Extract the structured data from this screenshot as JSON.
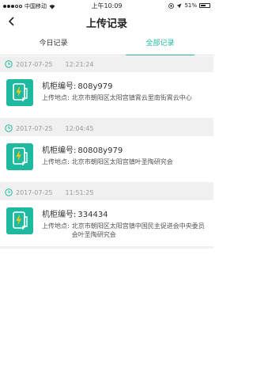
{
  "status_bar": {
    "carrier": "中国移动",
    "time": "上午10:09",
    "battery": "51%",
    "battery_level": 0.51
  },
  "nav": {
    "title": "上传记录"
  },
  "tabs": [
    {
      "label": "今日记录",
      "active": false
    },
    {
      "label": "全部记录",
      "active": true
    }
  ],
  "records": [
    {
      "date": "2017-07-25",
      "time": "12:21:24",
      "cabinet_label": "机柜编号:",
      "cabinet_no": "808y979",
      "location_label": "上传地点:",
      "location": "北京市朝阳区太阳宫镇霄云里南街霄云中心"
    },
    {
      "date": "2017-07-25",
      "time": "12:04:45",
      "cabinet_label": "机柜编号:",
      "cabinet_no": "80808y979",
      "location_label": "上传地点:",
      "location": "北京市朝阳区太阳宫镇叶圣陶研究会"
    },
    {
      "date": "2017-07-25",
      "time": "11:51:25",
      "cabinet_label": "机柜编号:",
      "cabinet_no": "334434",
      "location_label": "上传地点:",
      "location": "北京市朝阳区太阳宫镇中国民主促进会中央委员会叶圣陶研究会"
    }
  ],
  "colors": {
    "accent": "#1fb9a0",
    "background": "#f0f0f0"
  }
}
